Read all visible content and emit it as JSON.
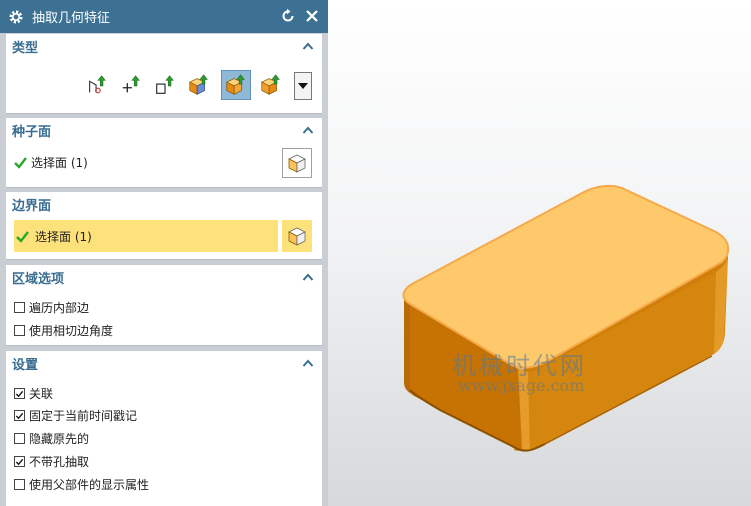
{
  "dialog": {
    "title": "抽取几何特征",
    "icons": {
      "settings": "gear-icon",
      "reset": "reset-icon",
      "close": "close-icon"
    }
  },
  "type_group": {
    "header": "类型",
    "tools": [
      "composite-curve-icon",
      "point-icon",
      "datum-icon",
      "body-icon",
      "region-of-faces-icon",
      "face-icon"
    ],
    "selected_tool_index": 4
  },
  "seed_face": {
    "header": "种子面",
    "select_label": "选择面 (1)"
  },
  "boundary_face": {
    "header": "边界面",
    "select_label": "选择面 (1)"
  },
  "region_options": {
    "header": "区域选项",
    "options": [
      {
        "label": "遍历内部边",
        "checked": false
      },
      {
        "label": "使用相切边角度",
        "checked": false
      }
    ]
  },
  "settings": {
    "header": "设置",
    "options": [
      {
        "label": "关联",
        "checked": true
      },
      {
        "label": "固定于当前时间戳记",
        "checked": true
      },
      {
        "label": "隐藏原先的",
        "checked": false
      },
      {
        "label": "不带孔抽取",
        "checked": true
      },
      {
        "label": "使用父部件的显示属性",
        "checked": false
      }
    ]
  },
  "watermark": {
    "line1": "机械时代网",
    "line2": "www.jxage.com"
  },
  "colors": {
    "title_bar": "#3d7193",
    "header_text": "#3a6e91",
    "highlight": "#fde17a",
    "box_top": "#fdc96a",
    "box_side": "#d27f0a"
  }
}
